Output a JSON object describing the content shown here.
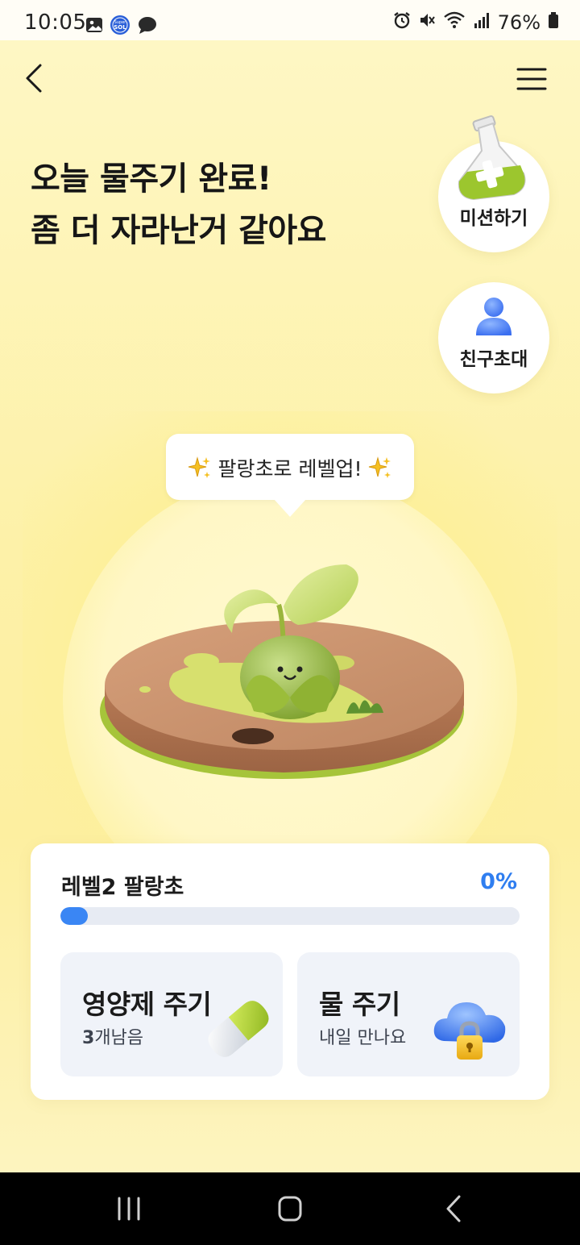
{
  "status_bar": {
    "time": "10:05",
    "left_icons": [
      "gallery-icon",
      "super-sol-icon",
      "chat-bubble-icon"
    ],
    "super_sol_text": "Super SOL",
    "right_icons": [
      "alarm-icon",
      "mute-icon",
      "wifi-icon",
      "signal-icon"
    ],
    "battery": "76%"
  },
  "header": {
    "back_icon": "chevron-left-icon",
    "menu_icon": "hamburger-menu-icon"
  },
  "headline": {
    "line1": "오늘 물주기 완료!",
    "line2": "좀 더 자라난거 같아요"
  },
  "side_buttons": {
    "mission": {
      "label": "미션하기",
      "icon": "flask-icon"
    },
    "invite": {
      "label": "친구초대",
      "icon": "person-icon"
    }
  },
  "speech_bubble": {
    "text": "팔랑초로 레벨업!",
    "icon": "sparkles-icon"
  },
  "plant": {
    "illustration": "sprout-on-disk"
  },
  "level_card": {
    "level_label": "레벨2 팔랑초",
    "progress_text": "0%",
    "progress_fraction": 0.0,
    "tiles": [
      {
        "title": "영양제 주기",
        "count": "3",
        "sub_suffix": "개남음",
        "icon": "pill-capsule-icon"
      },
      {
        "title": "물 주기",
        "sub": "내일 만나요",
        "icon": "locked-cloud-icon"
      }
    ]
  },
  "nav_bar": {
    "icons": [
      "recent-apps-icon",
      "home-icon",
      "back-icon"
    ]
  },
  "colors": {
    "background": "#fdf3b8",
    "accent_blue": "#3a86f4",
    "progress_track": "#e7ebf3",
    "tile_bg": "#f0f3f9"
  }
}
